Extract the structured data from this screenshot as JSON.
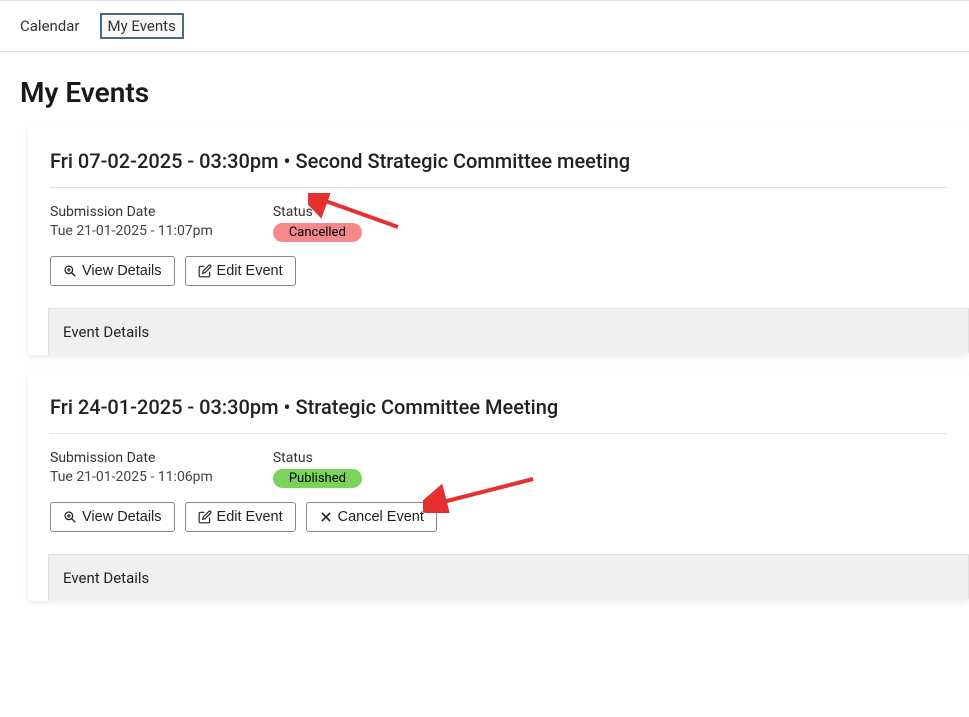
{
  "tabs": {
    "calendar": "Calendar",
    "my_events": "My Events"
  },
  "page_title": "My Events",
  "events": [
    {
      "title": "Fri 07-02-2025 - 03:30pm • Second Strategic Committee meeting",
      "submission_label": "Submission Date",
      "submission_value": "Tue 21-01-2025 - 11:07pm",
      "status_label": "Status",
      "status_value": "Cancelled",
      "status_class": "cancelled",
      "view_label": "View Details",
      "edit_label": "Edit Event",
      "cancel_label": "",
      "details_header": "Event Details"
    },
    {
      "title": "Fri 24-01-2025 - 03:30pm • Strategic Committee Meeting",
      "submission_label": "Submission Date",
      "submission_value": "Tue 21-01-2025 - 11:06pm",
      "status_label": "Status",
      "status_value": "Published",
      "status_class": "published",
      "view_label": "View Details",
      "edit_label": "Edit Event",
      "cancel_label": "Cancel Event",
      "details_header": "Event Details"
    }
  ]
}
